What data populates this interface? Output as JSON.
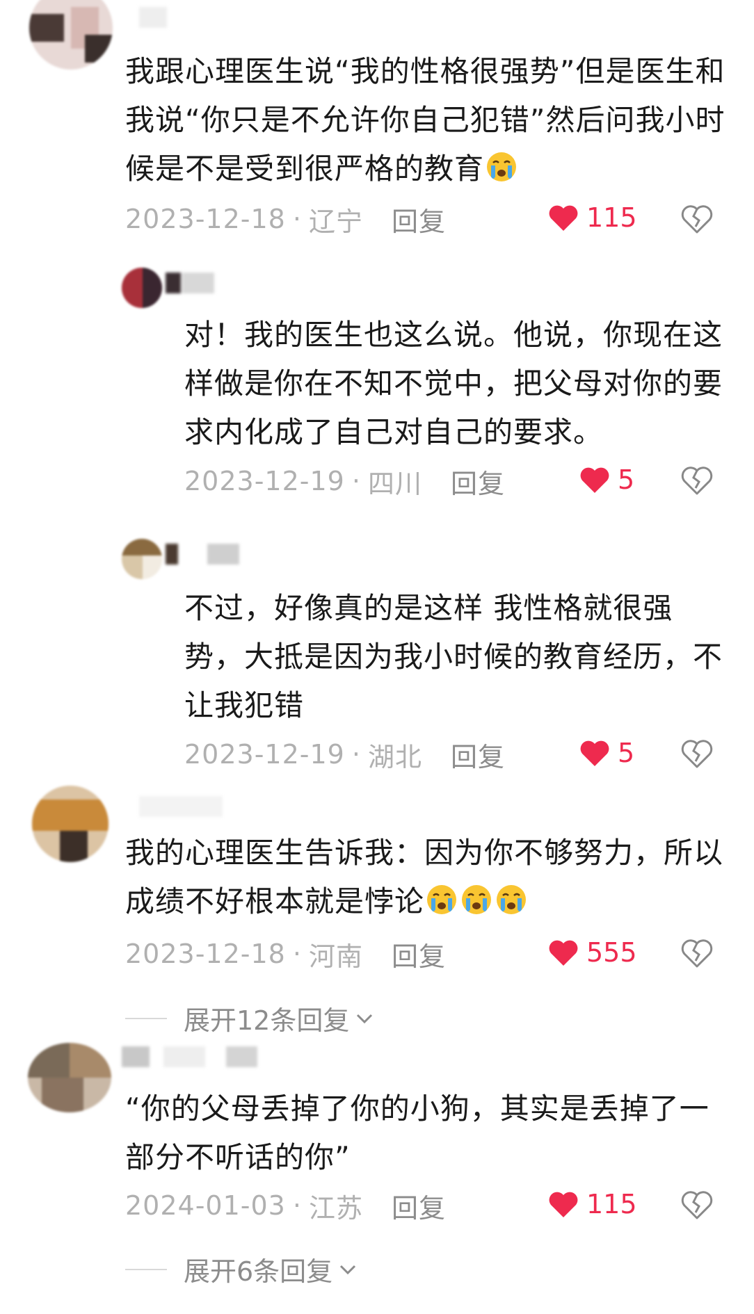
{
  "comments": [
    {
      "text": "我跟心理医生说“我的性格很强势”但是医生和我说“你只是不允许你自己犯错”然后问我小时候是不是受到很严格的教育",
      "emoji_count": 1,
      "date": "2023-12-18",
      "location": "辽宁",
      "reply_label": "回复",
      "likes": "115"
    },
    {
      "text": "对！我的医生也这么说。他说，你现在这样做是你在不知不觉中，把父母对你的要求内化成了自己对自己的要求。",
      "date": "2023-12-19",
      "location": "四川",
      "reply_label": "回复",
      "likes": "5"
    },
    {
      "text": "不过，好像真的是这样 我性格就很强势，大抵是因为我小时候的教育经历，不让我犯错",
      "date": "2023-12-19",
      "location": "湖北",
      "reply_label": "回复",
      "likes": "5"
    },
    {
      "text": "我的心理医生告诉我：因为你不够努力，所以成绩不好根本就是悖论",
      "emoji_count": 3,
      "date": "2023-12-18",
      "location": "河南",
      "reply_label": "回复",
      "likes": "555",
      "expand_label": "展开12条回复"
    },
    {
      "text": "“你的父母丢掉了你的小狗，其实是丢掉了一部分不听话的你”",
      "date": "2024-01-03",
      "location": "江苏",
      "reply_label": "回复",
      "likes": "115",
      "expand_label": "展开6条回复"
    }
  ],
  "colors": {
    "like_red": "#ee2a4e",
    "meta_gray": "#b0b0b0",
    "reply_gray": "#8c8c8c",
    "text": "#1a1a1a"
  },
  "icons": {
    "like": "heart-icon",
    "dislike": "broken-heart-icon",
    "expand": "chevron-down-icon",
    "emoji": "crying-face-emoji"
  }
}
